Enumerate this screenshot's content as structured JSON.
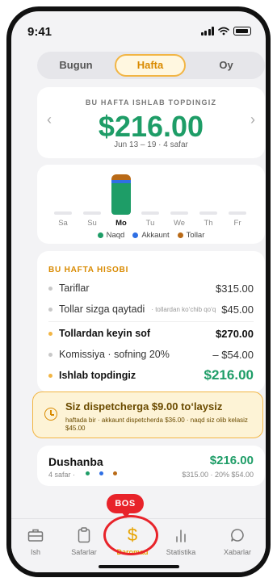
{
  "status": {
    "time": "9:41"
  },
  "period_tabs": [
    "Bugun",
    "Hafta",
    "Oy"
  ],
  "period_active": "Hafta",
  "summary": {
    "label": "BU HAFTA ISHLAB TOPDINGIZ",
    "amount": "$216.00",
    "range": "Jun 13 – 19 · 4 safar",
    "prev_icon": "chevron-left-icon",
    "next_icon": "chevron-right-icon"
  },
  "chart_data": {
    "type": "bar",
    "stacked": true,
    "categories": [
      "Sa",
      "Su",
      "Mo",
      "Tu",
      "We",
      "Th",
      "Fr"
    ],
    "active_category": "Mo",
    "series": [
      {
        "name": "Naqd",
        "color": "#1e9d67",
        "values": [
          0,
          0,
          32,
          0,
          0,
          0,
          0
        ]
      },
      {
        "name": "Akkaunt",
        "color": "#2f6fe4",
        "values": [
          0,
          0,
          3,
          0,
          0,
          0,
          0
        ]
      },
      {
        "name": "Tollar",
        "color": "#b96a17",
        "values": [
          0,
          0,
          6,
          0,
          0,
          0,
          0
        ]
      }
    ]
  },
  "report": {
    "title": "BU HAFTA HISOBI",
    "rows": [
      {
        "label": "Tariflar",
        "note": "",
        "value": "$315.00"
      },
      {
        "label": "Tollar sizga qaytadi",
        "note": "· tollardan ko‘chib qo‘q",
        "value": "$45.00"
      },
      {
        "label": "Tollardan keyin sof",
        "note": "",
        "value": "$270.00"
      },
      {
        "label": "Komissiya · sofning 20%",
        "note": "",
        "value": "– $54.00"
      },
      {
        "label": "Ishlab topdingiz",
        "note": "",
        "value": "$216.00"
      }
    ]
  },
  "dispatcher": {
    "title": "Siz dispetcherga $9.00 to‘laysiz",
    "subtitle": "haftada bir · akkaunt dispetcherda $36.00 · naqd siz olib kelasiz $45.00",
    "icon": "clock-icon"
  },
  "day_row": {
    "name": "Dushanba",
    "total": "$216.00",
    "trips": "4 safar ·",
    "detail": "$315.00 · 20% $54.00"
  },
  "badge": {
    "text": "BOS"
  },
  "tabs": [
    {
      "label": "Ish",
      "icon": "briefcase-icon"
    },
    {
      "label": "Safarlar",
      "icon": "clipboard-icon"
    },
    {
      "label": "Daromad",
      "icon": "dollar-icon"
    },
    {
      "label": "Statistika",
      "icon": "bar-chart-icon"
    },
    {
      "label": "Xabarlar",
      "icon": "chat-bubble-icon"
    }
  ],
  "active_tab": "Daromad",
  "colors": {
    "green": "#1e9d67",
    "gold": "#f2b544",
    "red": "#e8232a",
    "blue": "#2f6fe4",
    "brown": "#b96a17"
  }
}
